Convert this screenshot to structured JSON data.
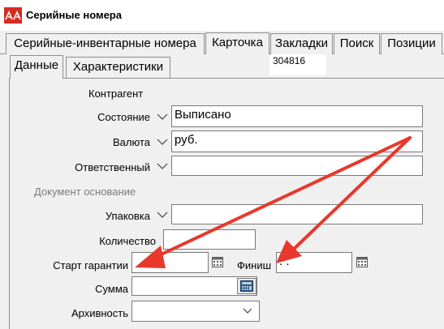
{
  "window": {
    "title": "Серийные номера"
  },
  "outer_tabs": [
    {
      "label": "Серийные-инвентарные номера"
    },
    {
      "label": "Карточка"
    },
    {
      "label": "Закладки"
    },
    {
      "label": "Поиск"
    },
    {
      "label": "Позиции"
    }
  ],
  "inner_tabs": [
    {
      "label": "Данные"
    },
    {
      "label": "Характеристики"
    }
  ],
  "record_id": "304816",
  "form": {
    "kontragent_label": "Контрагент",
    "state": {
      "label": "Состояние",
      "value": "Выписано"
    },
    "currency": {
      "label": "Валюта",
      "value": "руб."
    },
    "responsible": {
      "label": "Ответственный",
      "value": ""
    },
    "doc_basis_label": "Документ основание",
    "package": {
      "label": "Упаковка",
      "value": ""
    },
    "quantity": {
      "label": "Количество",
      "value": ""
    },
    "warranty_start": {
      "label": "Старт гарантии",
      "value": ""
    },
    "finish": {
      "label": "Финиш",
      "value": " .  ."
    },
    "sum": {
      "label": "Сумма",
      "value": ""
    },
    "archive": {
      "label": "Архивность",
      "value": ""
    }
  },
  "colors": {
    "annotation_arrow": "#e8382c",
    "app_icon": "#d62b1f"
  }
}
